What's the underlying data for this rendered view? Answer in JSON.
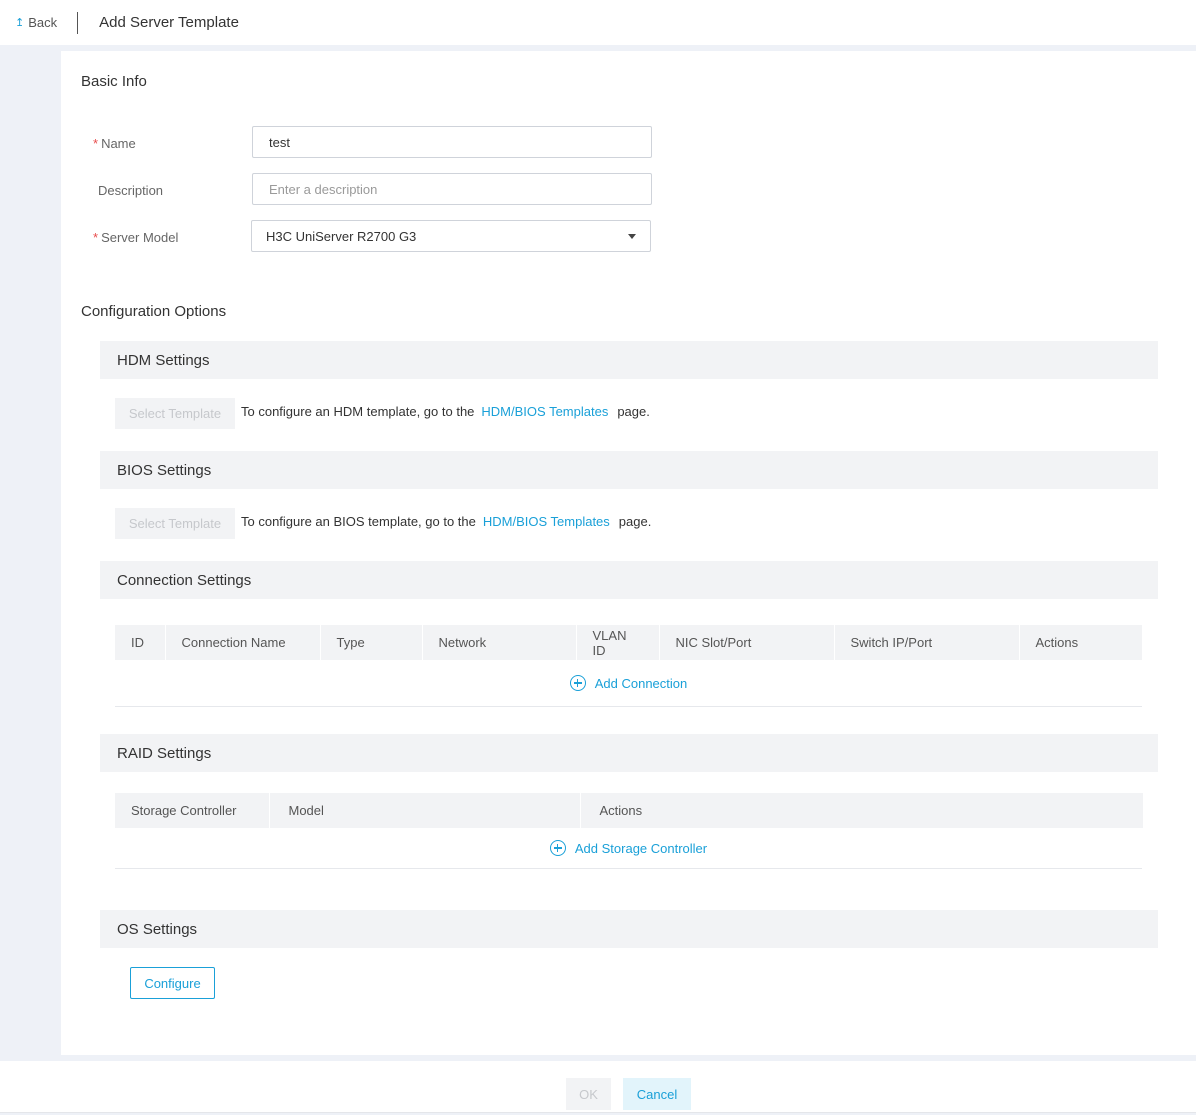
{
  "header": {
    "back_label": "Back",
    "title": "Add Server Template"
  },
  "basic_info": {
    "title": "Basic Info",
    "name": {
      "label": "Name",
      "value": "test",
      "required": "*"
    },
    "description": {
      "label": "Description",
      "placeholder": "Enter a description",
      "value": ""
    },
    "server_model": {
      "label": "Server Model",
      "value": "H3C UniServer R2700 G3",
      "required": "*"
    }
  },
  "config": {
    "title": "Configuration Options",
    "hdm": {
      "title": "HDM Settings",
      "select_label": "Select Template",
      "hint_before": "To configure an HDM template, go to the",
      "link": "HDM/BIOS Templates",
      "hint_after": "page."
    },
    "bios": {
      "title": "BIOS Settings",
      "select_label": "Select Template",
      "hint_before": "To configure an BIOS template, go to the",
      "link": "HDM/BIOS Templates",
      "hint_after": "page."
    },
    "connection": {
      "title": "Connection Settings",
      "columns": [
        "ID",
        "Connection Name",
        "Type",
        "Network",
        "VLAN ID",
        "NIC Slot/Port",
        "Switch IP/Port",
        "Actions"
      ],
      "add_label": "Add Connection"
    },
    "raid": {
      "title": "RAID Settings",
      "columns": [
        "Storage Controller",
        "Model",
        "Actions"
      ],
      "add_label": "Add Storage Controller"
    },
    "os": {
      "title": "OS Settings",
      "configure_label": "Configure"
    }
  },
  "footer": {
    "ok_label": "OK",
    "cancel_label": "Cancel"
  },
  "colors": {
    "accent": "#1aa0d8",
    "required": "#e84b4b",
    "header_bg": "#f2f3f5",
    "page_bg": "#eef1f7"
  }
}
